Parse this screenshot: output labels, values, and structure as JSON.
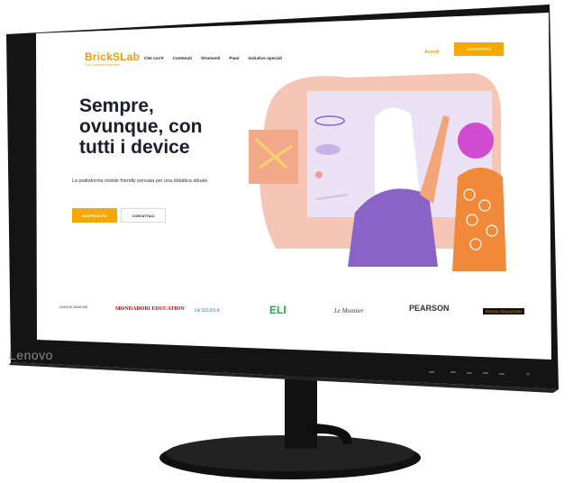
{
  "bezel": {
    "brand": "Lenovo"
  },
  "site": {
    "logo": "BrickSLab",
    "logo_tagline": "il tuo cantiere creativo",
    "nav": [
      "Che cos'è",
      "Contenuti",
      "Strumenti",
      "Piani",
      "Iniziative speciali"
    ],
    "login": "Accedi",
    "cta_label": "CONTATTACI",
    "hero_lines": [
      "Sempre,",
      "ovunque, con",
      "tutti i device"
    ],
    "description": "La piattaforma mobile friendly pensata per una didattica attuale",
    "button_more": "SCOPRI DI PIÙ",
    "button_contact": "CONTATTACI",
    "partners": [
      "LINGUE AMICHE",
      "MONDADORI EDUCATION",
      "LA SCUOLA",
      "ELI",
      "Le Monnier",
      "PEARSON",
      "RIZZOLI EDUCATION"
    ]
  },
  "colors": {
    "accent": "#f6a800",
    "bezel": "#151515",
    "illustration_purple": "#8a63c7",
    "illustration_salmon": "#f3b6a3",
    "text_dark": "#1d1d2f"
  }
}
